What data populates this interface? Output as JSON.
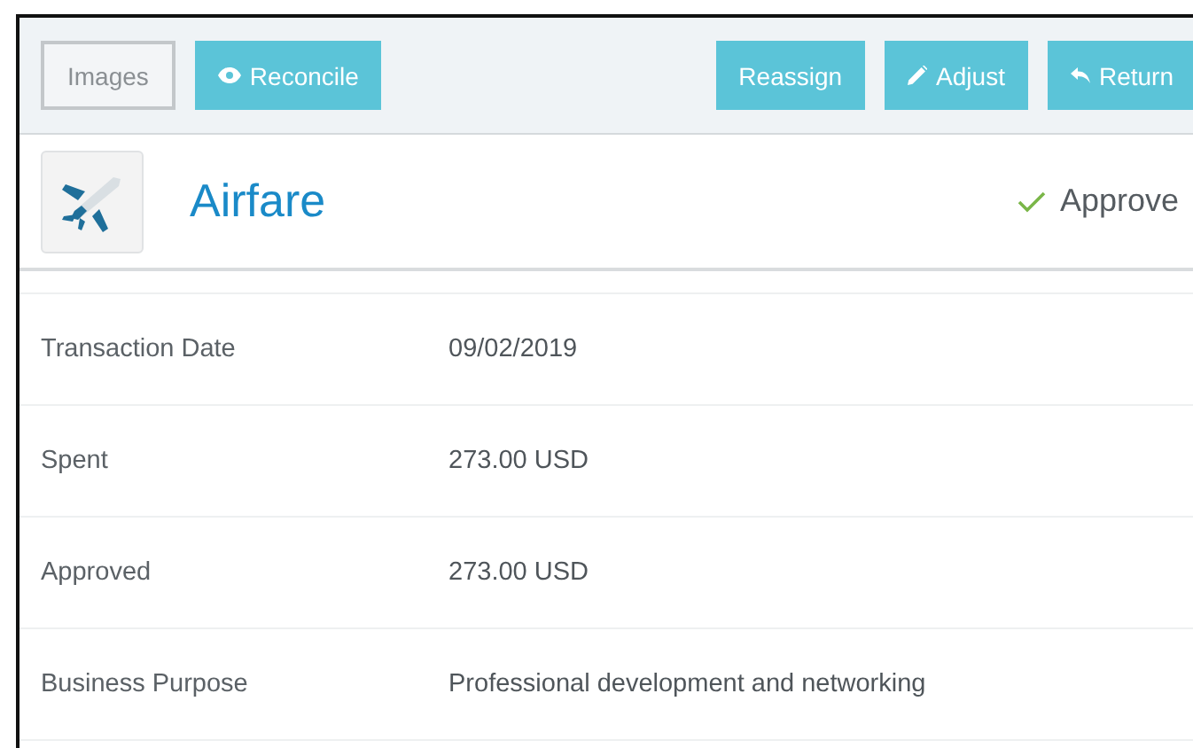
{
  "toolbar": {
    "left_buttons": [
      {
        "label": "Images",
        "kind": "outline"
      },
      {
        "label": "Reconcile",
        "kind": "solid"
      }
    ],
    "right_buttons": [
      {
        "label": "Reassign",
        "kind": "solid"
      },
      {
        "label": "Adjust",
        "kind": "solid"
      },
      {
        "label": "Return",
        "kind": "solid"
      }
    ]
  },
  "header": {
    "title": "Airfare",
    "action": "Approve"
  },
  "details": [
    {
      "label": "Transaction Date",
      "value": "09/02/2019"
    },
    {
      "label": "Spent",
      "value": "273.00 USD"
    },
    {
      "label": "Approved",
      "value": "273.00 USD"
    },
    {
      "label": "Business Purpose",
      "value": "Professional development and networking"
    }
  ]
}
